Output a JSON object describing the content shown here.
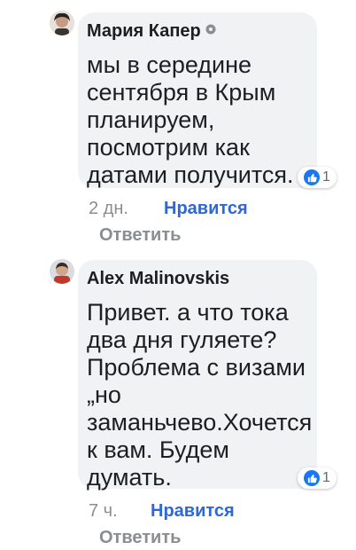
{
  "comments": [
    {
      "author": "Мария Капер",
      "text": "мы в середине сентября в Крым планируем, посмотрим как датами получится.",
      "reaction_count": "1",
      "time": "2 дн.",
      "like_label": "Нравится",
      "reply_label": "Ответить",
      "reaction_icon": "like-icon",
      "author_badge_icon": "gear-icon"
    },
    {
      "author": "Alex Malinovskis",
      "text": "Привет. а что тока два дня гуляете? Проблема с визами „но заманьчево.Хочется к вам. Будем думать.",
      "reaction_count": "1",
      "time": "7 ч.",
      "like_label": "Нравится",
      "reply_label": "Ответить",
      "reaction_icon": "like-icon"
    }
  ],
  "colors": {
    "bubble_bg": "#f1f2f4",
    "link_blue": "#2f66d8",
    "meta_gray": "#8a8d91",
    "text": "#1c1e21",
    "like_blue": "#1877f2"
  }
}
